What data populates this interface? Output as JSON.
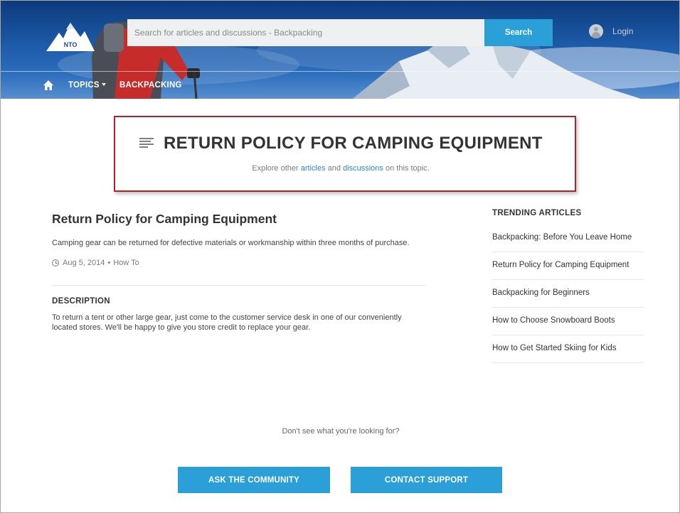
{
  "header": {
    "logo_text": "NTO",
    "search": {
      "placeholder": "Search for articles and discussions - Backpacking",
      "button_label": "Search"
    },
    "login_label": "Login",
    "nav": {
      "topics_label": "TOPICS",
      "backpacking_label": "BACKPACKING"
    }
  },
  "title_box": {
    "title": "RETURN POLICY FOR CAMPING EQUIPMENT",
    "explore_prefix": "Explore other",
    "articles_link": "articles",
    "and_text": "and",
    "discussions_link": "discussions",
    "explore_suffix": "on this topic."
  },
  "article": {
    "title": "Return Policy for Camping Equipment",
    "summary": "Camping gear can be returned for defective materials or workmanship within three months of purchase.",
    "date": "Aug 5, 2014",
    "separator": "•",
    "type": "How To",
    "description_heading": "DESCRIPTION",
    "description_body": "To return a tent or other large gear, just come to the customer service desk in one of our conveniently located stores. We'll be happy to give you store credit to replace your gear."
  },
  "trending": {
    "heading": "TRENDING ARTICLES",
    "items": [
      "Backpacking: Before You Leave Home",
      "Return Policy for Camping Equipment",
      "Backpacking for Beginners",
      "How to Choose Snowboard Boots",
      "How to Get Started Skiing for Kids"
    ]
  },
  "footer": {
    "prompt": "Don't see what you're looking for?",
    "ask_label": "ASK THE COMMUNITY",
    "contact_label": "CONTACT SUPPORT"
  },
  "colors": {
    "accent": "#2a9fd8",
    "link": "#2a86c6",
    "highlight_border": "#a4272b"
  }
}
